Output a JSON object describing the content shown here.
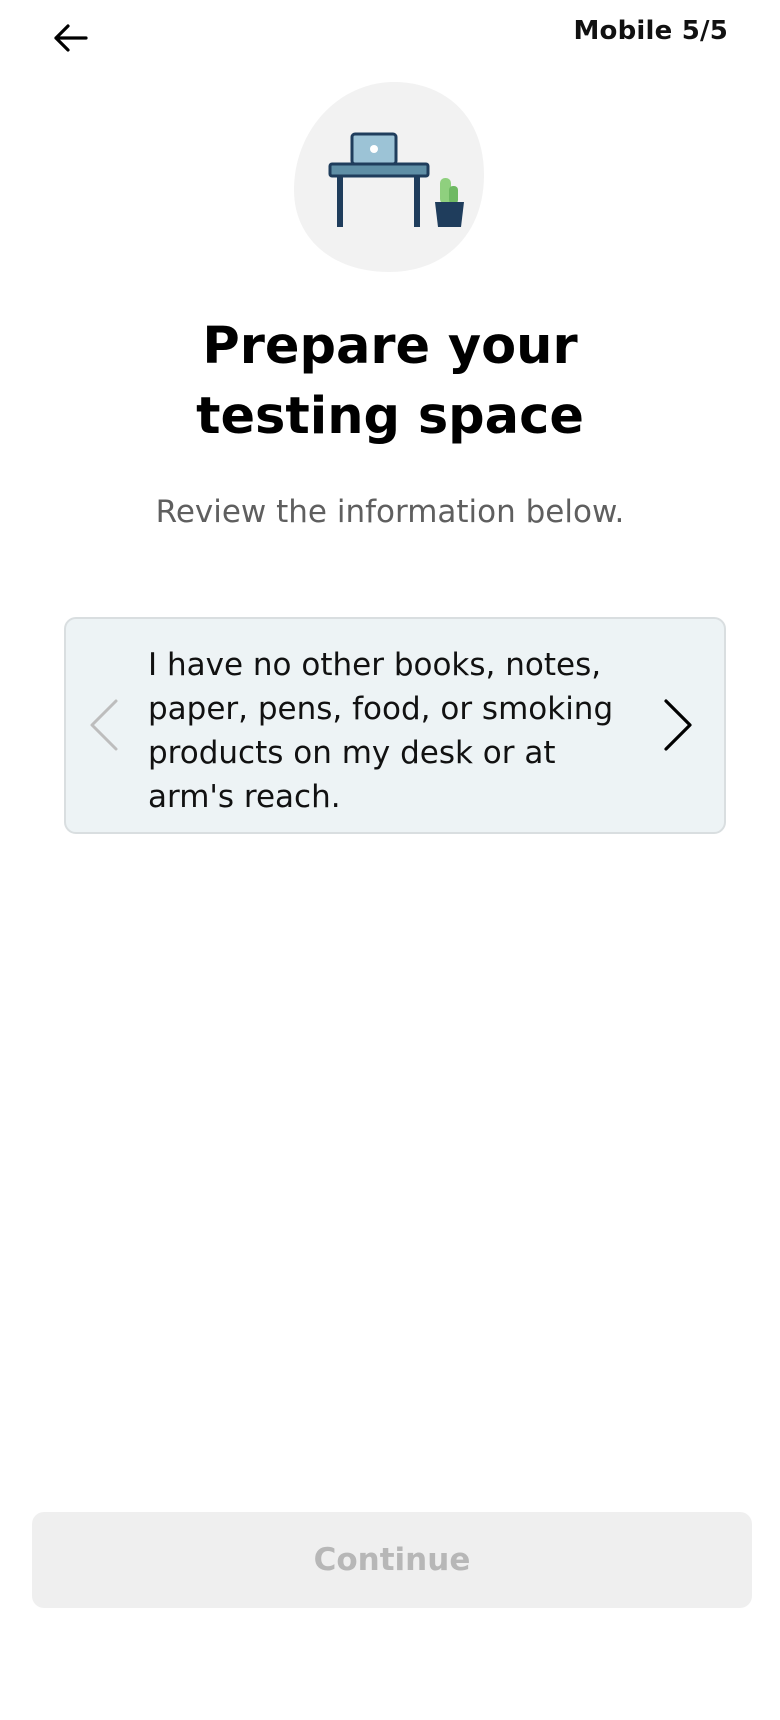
{
  "header": {
    "back_icon": "arrow-left-icon",
    "progress_label": "Mobile 5/5"
  },
  "illustration": {
    "icon": "desk-with-laptop-and-plant-illustration",
    "colors": {
      "blob": "#f2f2f2",
      "desk_top": "#5f8fa6",
      "desk_legs": "#1f3d5c",
      "laptop": "#9cc3d6",
      "pot": "#1f3d5c",
      "plant": "#8fd07e"
    }
  },
  "main": {
    "title_line1": "Prepare your",
    "title_line2": "testing space",
    "subtitle": "Review the information below."
  },
  "card": {
    "text": "I have no other books, notes, paper, pens, food, or smoking products on my desk or at arm's reach.",
    "prev_icon": "chevron-left-icon",
    "next_icon": "chevron-right-icon",
    "background": "#edf3f5"
  },
  "footer": {
    "continue_label": "Continue",
    "continue_state": "disabled"
  }
}
